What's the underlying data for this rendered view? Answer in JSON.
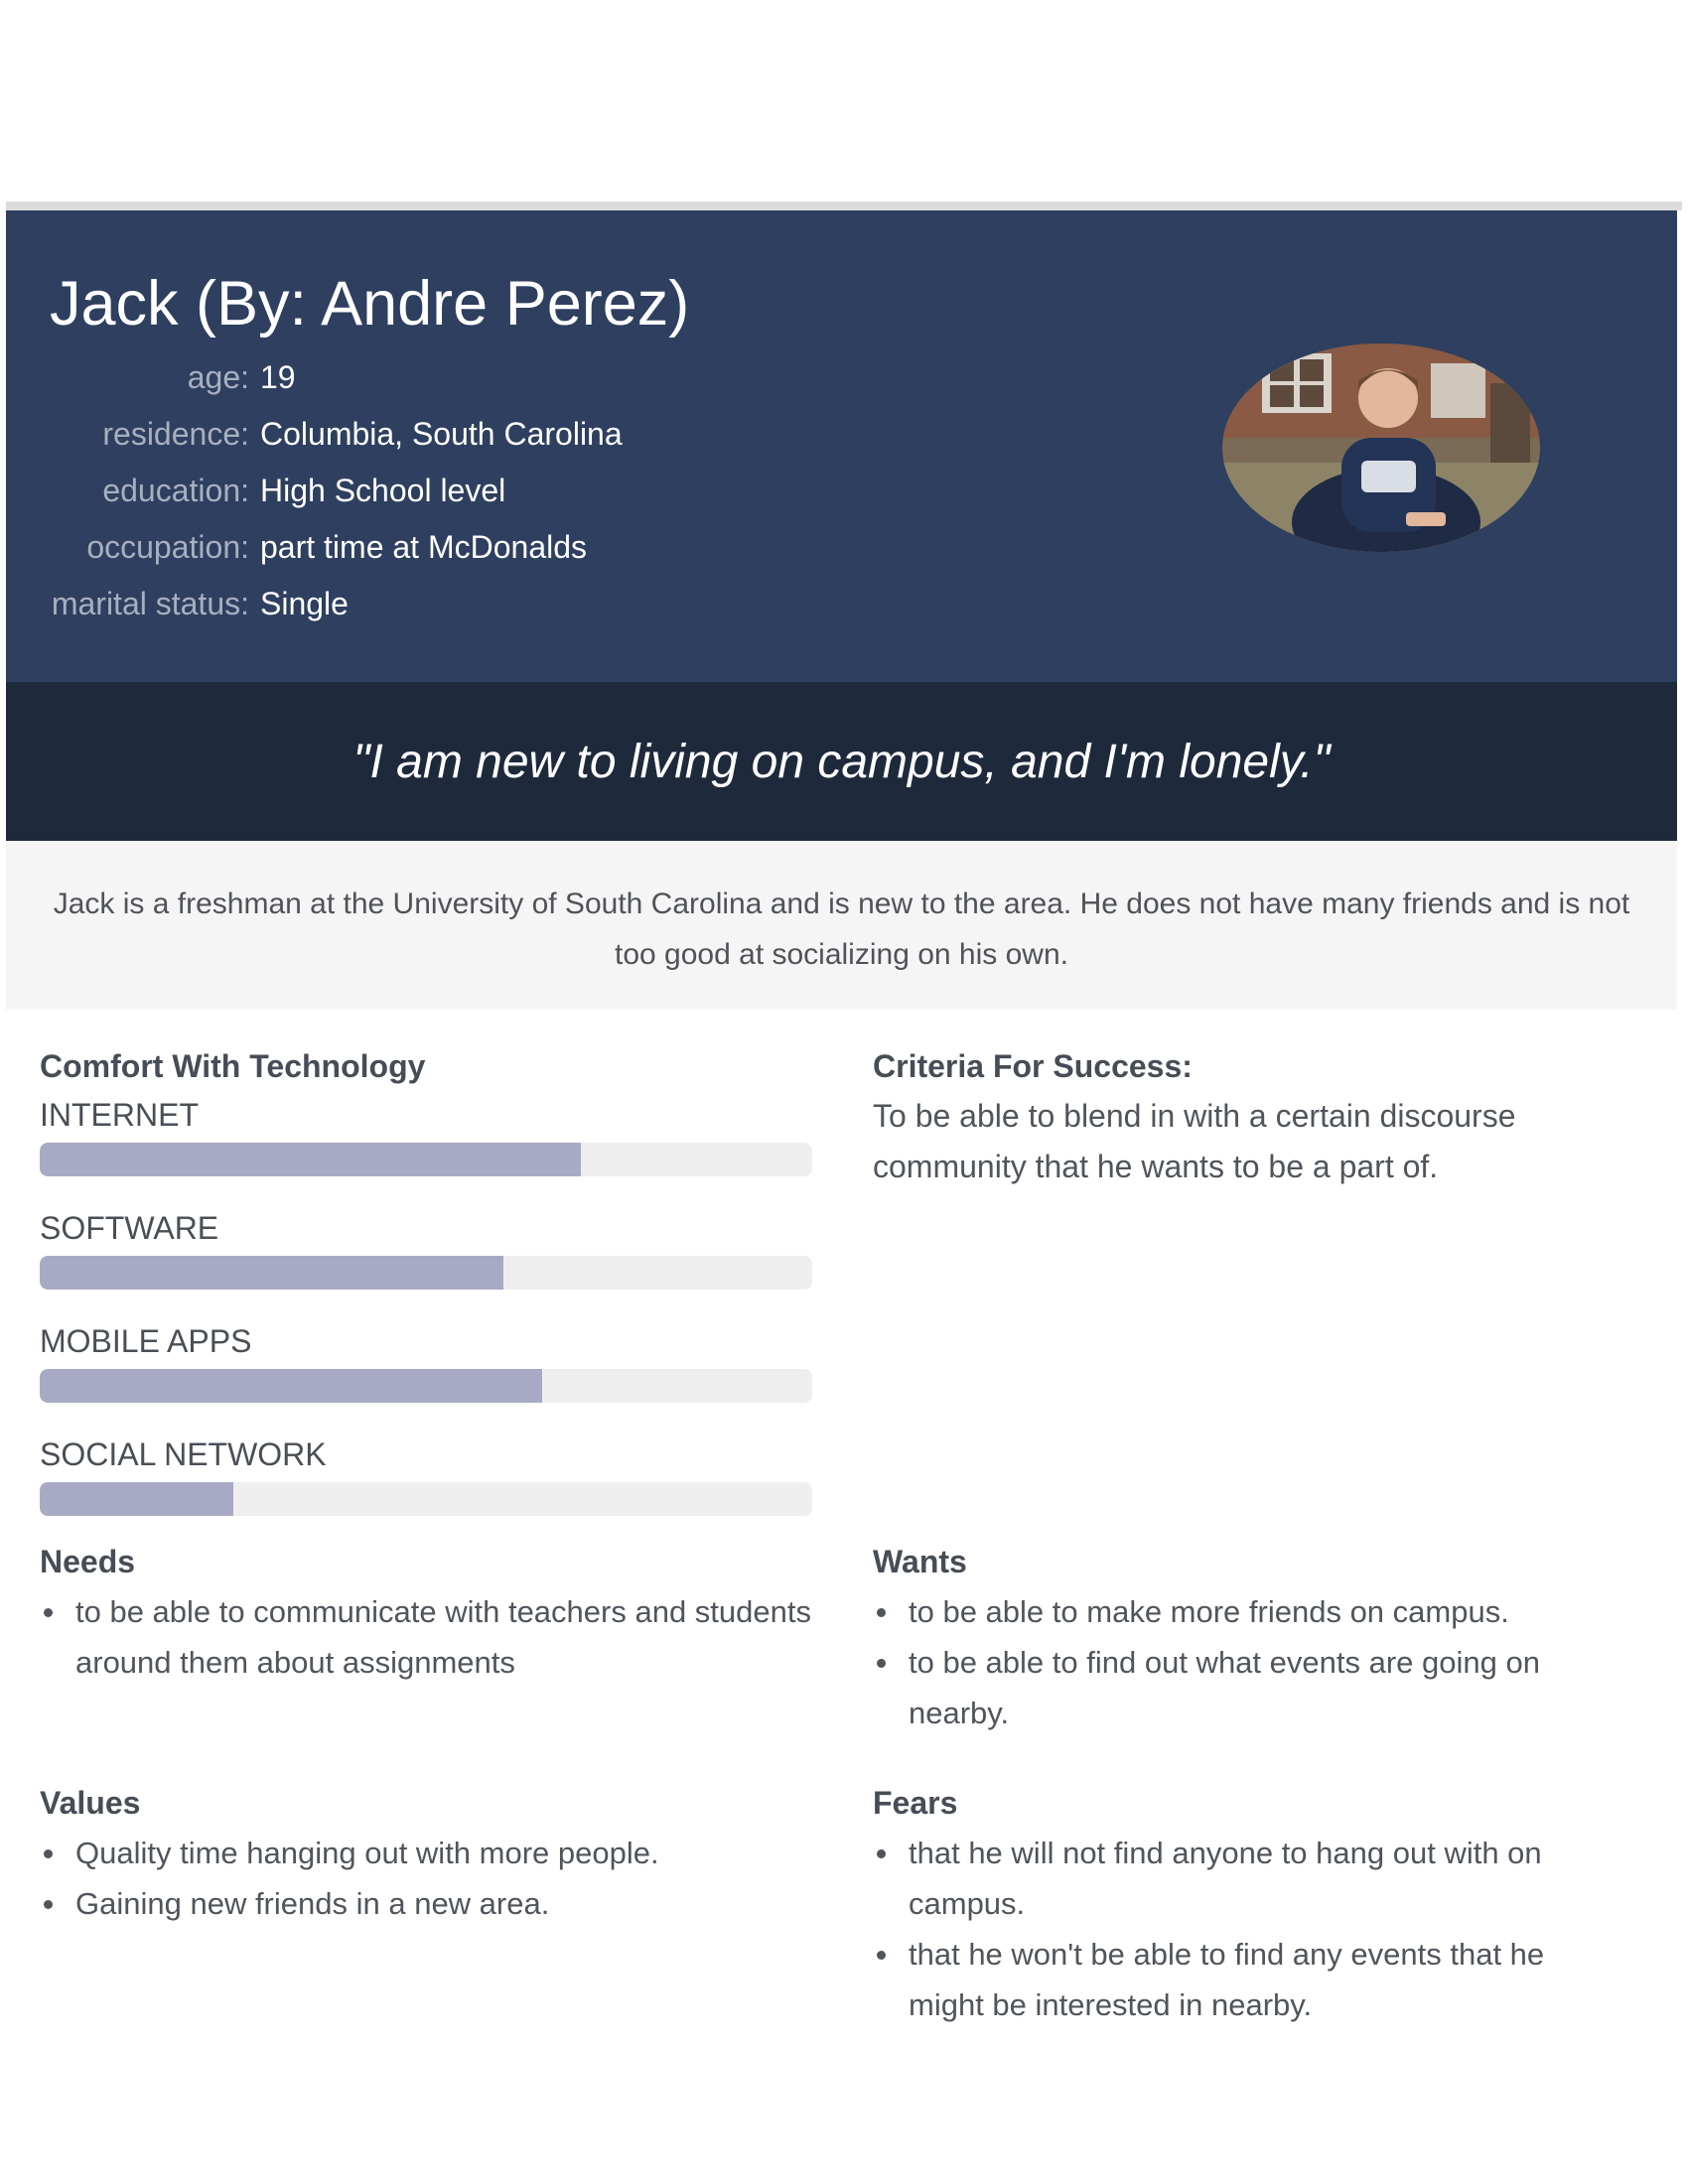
{
  "persona": {
    "name": "Jack (By: Andre Perez)",
    "facts": [
      {
        "label": "age:",
        "value": "19"
      },
      {
        "label": "residence:",
        "value": "Columbia, South Carolina"
      },
      {
        "label": "education:",
        "value": "High School level"
      },
      {
        "label": "occupation:",
        "value": "part time at McDonalds"
      },
      {
        "label": "marital status:",
        "value": "Single"
      }
    ],
    "quote": "\"I am new to living on campus, and I'm lonely.\"",
    "bio": "Jack is a freshman at the University of South Carolina and is new to the area. He does not have many friends and is not too good at socializing on his own."
  },
  "technology": {
    "title": "Comfort With Technology",
    "skills": [
      {
        "label": "INTERNET",
        "level": 0.7
      },
      {
        "label": "SOFTWARE",
        "level": 0.6
      },
      {
        "label": "MOBILE APPS",
        "level": 0.65
      },
      {
        "label": "SOCIAL NETWORK",
        "level": 0.25
      }
    ]
  },
  "success": {
    "title": "Criteria For Success:",
    "text": "To be able to blend in with a certain discourse community that he wants to be a part of."
  },
  "needs": {
    "title": "Needs",
    "items": [
      "to be able to communicate with teachers and students around them about assignments"
    ]
  },
  "wants": {
    "title": "Wants",
    "items": [
      "to be able to make more friends on campus.",
      "to be able to find out what events are going on nearby."
    ]
  },
  "values": {
    "title": "Values",
    "items": [
      "Quality time hanging out with more people.",
      "Gaining new friends in a new area."
    ]
  },
  "fears": {
    "title": "Fears",
    "items": [
      "that he will not find anyone to hang out with on campus.",
      "that he won't be able to find any events that he might be interested in nearby."
    ]
  },
  "colors": {
    "header_bg": "#2e3f5f",
    "quote_bg": "#1e2a3c",
    "bar_fill": "#a8aac5",
    "bar_track": "#eeeeef"
  }
}
